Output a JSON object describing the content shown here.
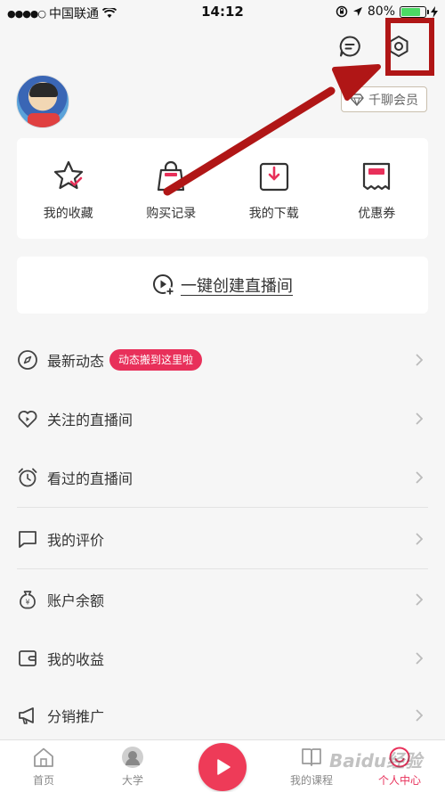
{
  "status_bar": {
    "signal_dots": "●●●●○",
    "carrier": "中国联通",
    "time": "14:12",
    "battery": "80%",
    "battery_level": 0.8
  },
  "header": {
    "vip_label": "千聊会员"
  },
  "quick_actions": [
    {
      "label": "我的收藏",
      "icon": "star-icon"
    },
    {
      "label": "购买记录",
      "icon": "shopping-bag-icon"
    },
    {
      "label": "我的下载",
      "icon": "download-icon"
    },
    {
      "label": "优惠券",
      "icon": "coupon-icon"
    }
  ],
  "live_create": {
    "label": "一键创建直播间"
  },
  "menu": [
    {
      "label": "最新动态",
      "badge": "动态搬到这里啦",
      "icon": "compass-icon"
    },
    {
      "label": "关注的直播间",
      "icon": "heart-play-icon"
    },
    {
      "label": "看过的直播间",
      "icon": "alarm-clock-icon"
    },
    {
      "label": "我的评价",
      "icon": "comment-icon"
    },
    {
      "label": "账户余额",
      "icon": "money-bag-icon"
    },
    {
      "label": "我的收益",
      "icon": "wallet-icon"
    },
    {
      "label": "分销推广",
      "icon": "megaphone-icon"
    }
  ],
  "tabs": [
    {
      "label": "首页",
      "icon": "home-icon"
    },
    {
      "label": "大学",
      "icon": "university-avatar-icon"
    },
    {
      "label": "我的课程",
      "icon": "book-icon"
    },
    {
      "label": "个人中心",
      "icon": "profile-icon",
      "active": true
    }
  ],
  "watermark": "Baidu经验",
  "colors": {
    "accent": "#e8305a",
    "highlight": "#b01616",
    "background": "#f6f6f6"
  }
}
